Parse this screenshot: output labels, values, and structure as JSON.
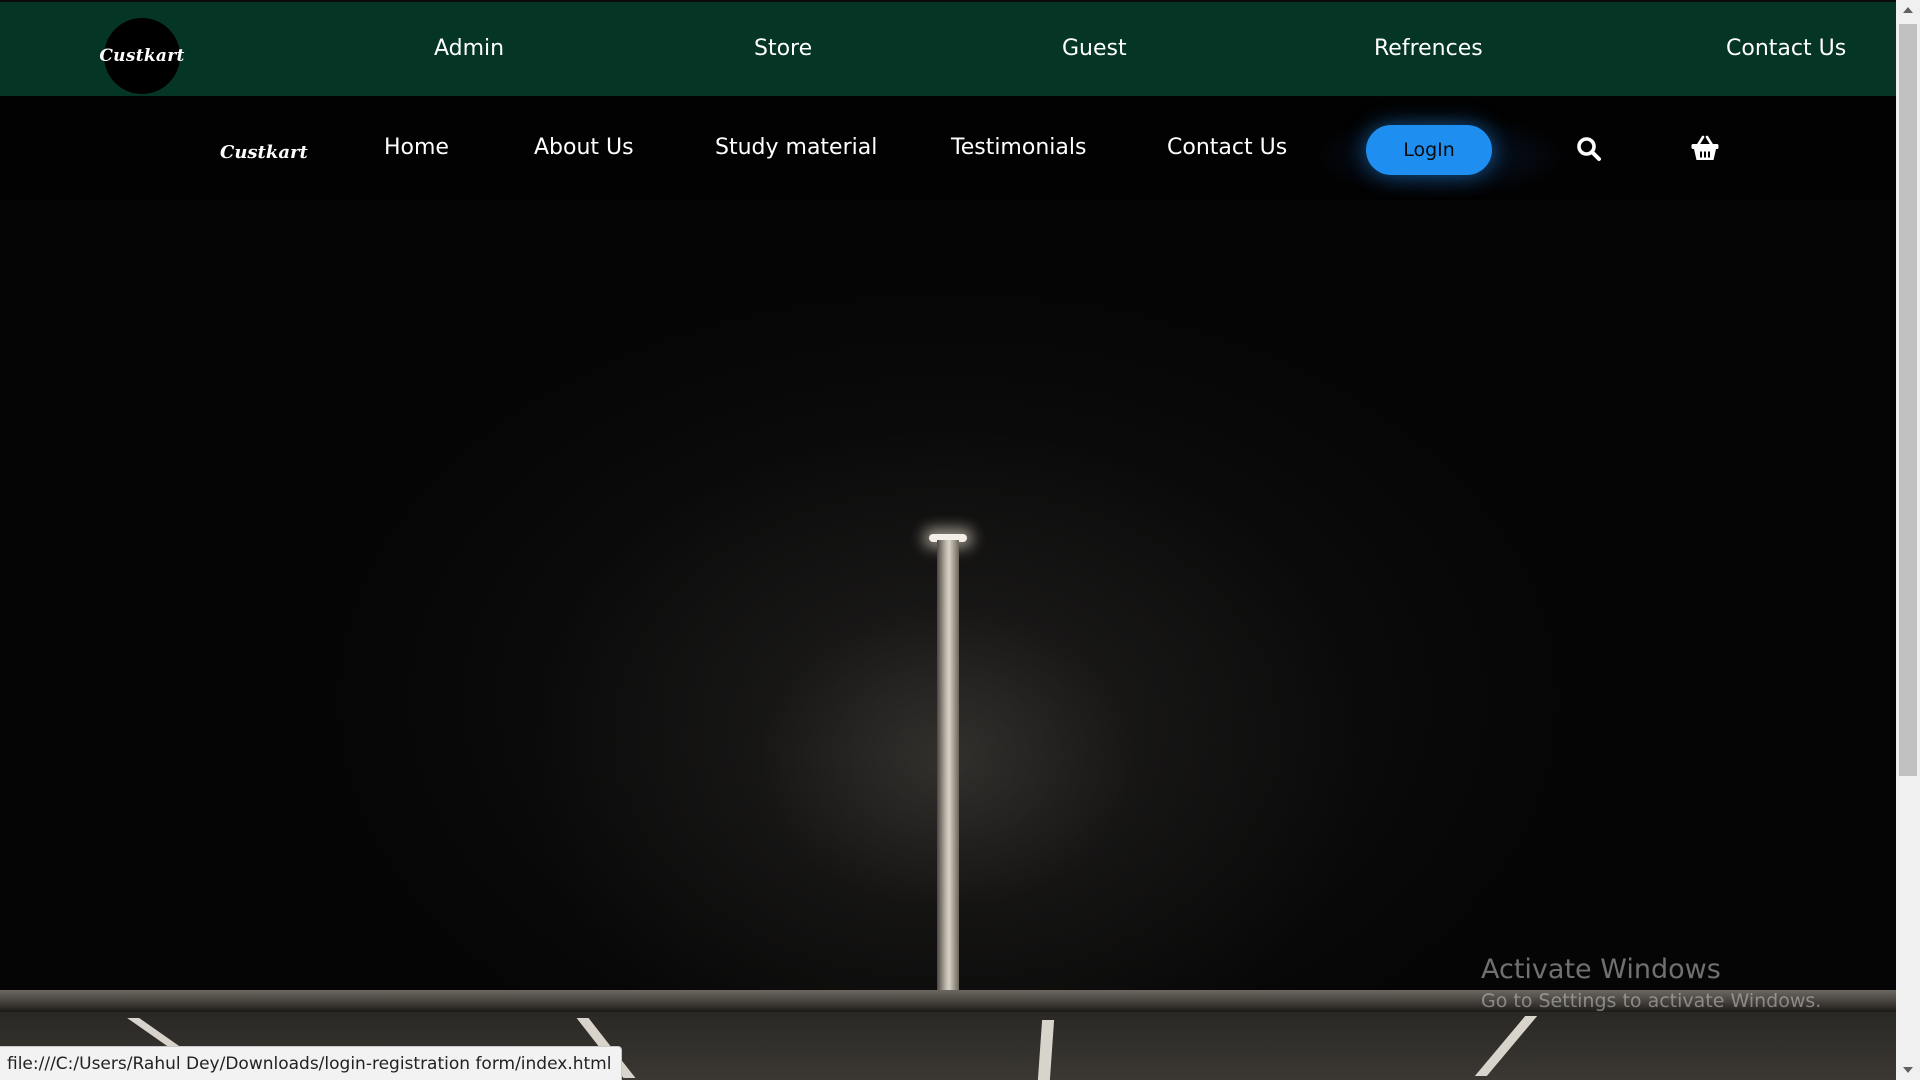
{
  "topbar": {
    "logo_text": "Custkart",
    "links": [
      "Admin",
      "Store",
      "Guest",
      "Refrences",
      "Contact Us"
    ],
    "background": "#053524"
  },
  "subnav": {
    "brand": "Custkart",
    "links": [
      "Home",
      "About Us",
      "Study material",
      "Testimonials",
      "Contact Us"
    ],
    "login_label": "LogIn",
    "login_color": "#1e8ff0",
    "search_icon": "search-icon",
    "cart_icon": "basket-icon"
  },
  "watermark": {
    "title": "Activate Windows",
    "subtitle": "Go to Settings to activate Windows."
  },
  "statusbar": {
    "url": "file:///C:/Users/Rahul Dey/Downloads/login-registration form/index.html"
  }
}
